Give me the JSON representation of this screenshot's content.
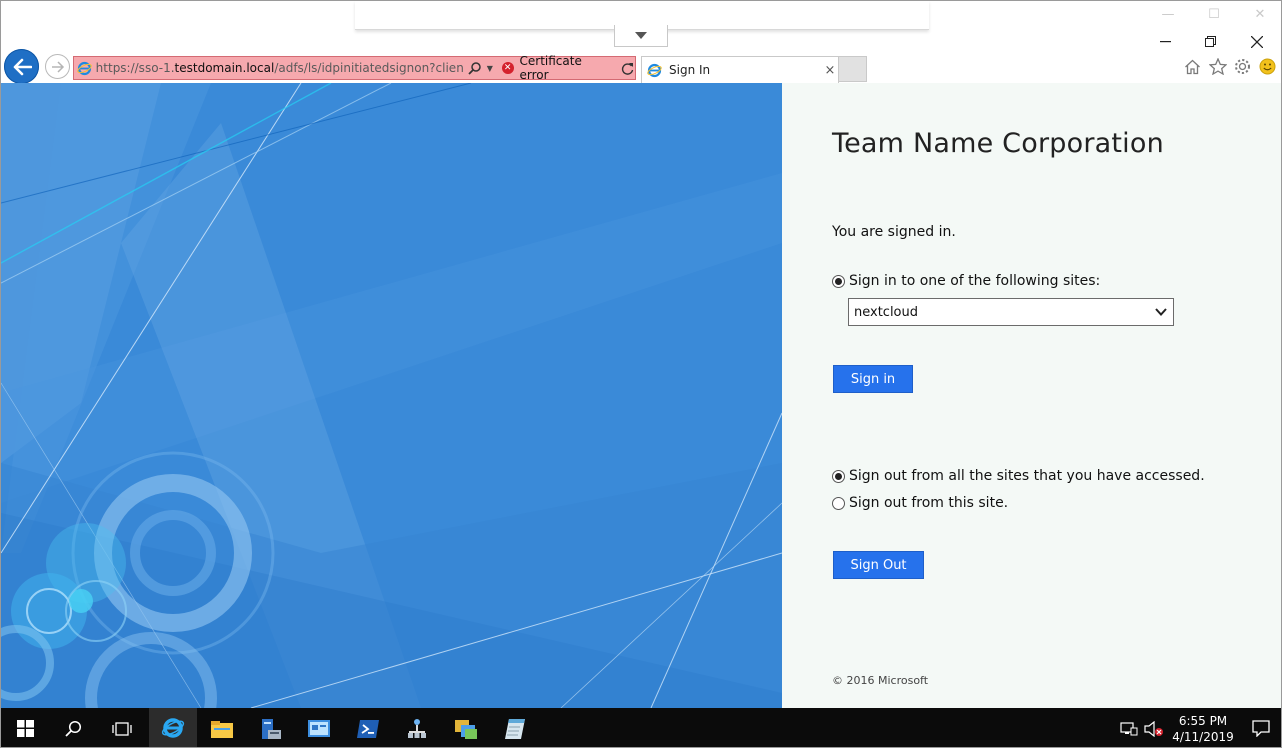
{
  "browser": {
    "address_prefix": "https://sso-1.",
    "address_host": "testdomain.local",
    "address_path": "/adfs/ls/idpinitiatedsignon?client-reques",
    "certificate_error": "Certificate error",
    "tab_title": "Sign In",
    "tab_close": "×",
    "icons": [
      "back-arrow-icon",
      "forward-arrow-icon",
      "ie-logo-icon",
      "search-icon",
      "dropdown-icon",
      "certificate-error-icon",
      "refresh-icon",
      "home-icon",
      "favorites-star-icon",
      "settings-gear-icon",
      "smiley-feedback-icon"
    ]
  },
  "page": {
    "company": "Team Name Corporation",
    "signed_in_text": "You are signed in.",
    "sign_in_option": "Sign in to one of the following sites:",
    "site_selected": "nextcloud",
    "sign_in_button": "Sign in",
    "sign_out_all_option": "Sign out from all the sites that you have accessed.",
    "sign_out_this_option": "Sign out from this site.",
    "sign_out_button": "Sign Out",
    "copyright": "© 2016 Microsoft",
    "colors": {
      "accent": "#2672ec",
      "panel_bg": "#f4f9f6",
      "illustration_bg": "#3a8ad8"
    }
  },
  "taskbar": {
    "time": "6:55 PM",
    "date": "4/11/2019",
    "apps": [
      "start-icon",
      "search-icon",
      "task-view-icon",
      "internet-explorer-icon",
      "file-explorer-icon",
      "server-manager-icon",
      "control-panel-icon",
      "powershell-icon",
      "network-icon",
      "admin-tools-icon",
      "notepad-icon"
    ]
  }
}
